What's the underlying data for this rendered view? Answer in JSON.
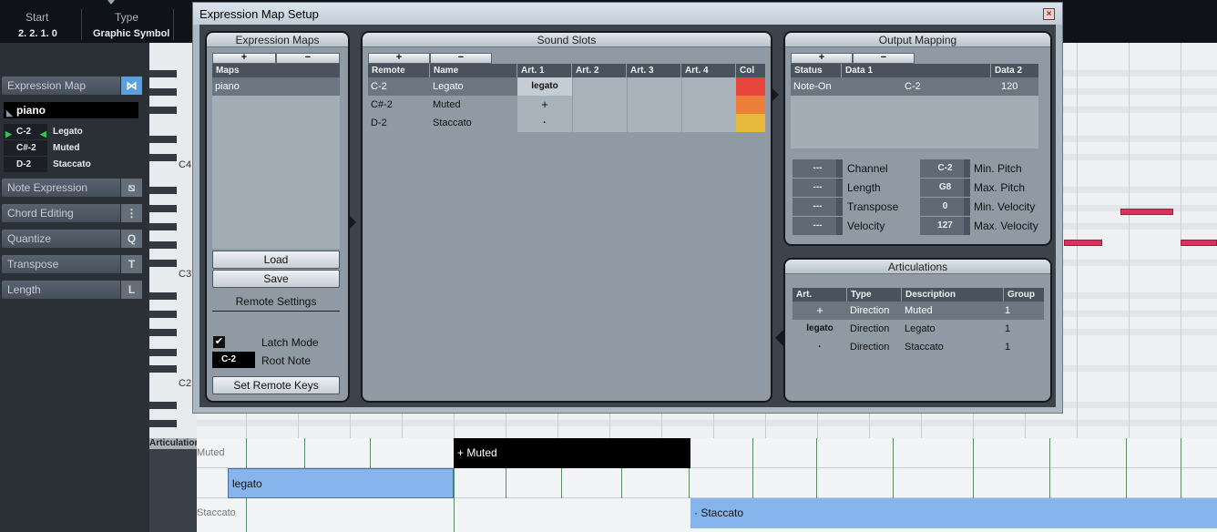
{
  "top_info": {
    "start_label": "Start",
    "start_value": "2. 2. 1.   0",
    "type_label": "Type",
    "type_value": "Graphic Symbol"
  },
  "inspector": {
    "expression_map_label": "Expression Map",
    "expression_map_value": "piano",
    "articulations": [
      {
        "note": "C-2",
        "name": "Legato",
        "playing": true
      },
      {
        "note": "C#-2",
        "name": "Muted",
        "playing": false
      },
      {
        "note": "D-2",
        "name": "Staccato",
        "playing": false
      }
    ],
    "sections": [
      {
        "label": "Note Expression",
        "icon": "note-expression-icon",
        "glyph": "⧅"
      },
      {
        "label": "Chord Editing",
        "icon": "chord-editing-icon",
        "glyph": "⋮"
      },
      {
        "label": "Quantize",
        "icon": "quantize-icon",
        "glyph": "Q"
      },
      {
        "label": "Transpose",
        "icon": "transpose-icon",
        "glyph": "T"
      },
      {
        "label": "Length",
        "icon": "length-icon",
        "glyph": "L"
      }
    ]
  },
  "keyboard": {
    "labels": [
      "C4",
      "C3",
      "C2"
    ]
  },
  "lanes": {
    "title": "Articulations",
    "rows": [
      {
        "label": "Muted",
        "bar_text": "+ Muted"
      },
      {
        "label": "",
        "bar_text": "legato"
      },
      {
        "label": "Staccato",
        "bar_text": "· Staccato"
      }
    ]
  },
  "dialog": {
    "title": "Expression Map Setup",
    "close": "×",
    "expression_maps": {
      "title": "Expression Maps",
      "add": "+",
      "remove": "−",
      "column": "Maps",
      "items": [
        "piano"
      ],
      "load": "Load",
      "save": "Save",
      "remote_settings": "Remote Settings",
      "latch_mode": "Latch Mode",
      "latch_checked": true,
      "root_note_value": "C-2",
      "root_note_label": "Root Note",
      "set_remote_keys": "Set Remote Keys"
    },
    "sound_slots": {
      "title": "Sound Slots",
      "add": "+",
      "remove": "−",
      "columns": [
        "Remote",
        "Name",
        "Art. 1",
        "Art. 2",
        "Art. 3",
        "Art. 4",
        "Col"
      ],
      "rows": [
        {
          "remote": "C-2",
          "name": "Legato",
          "art1": "legato",
          "art2": "",
          "art3": "",
          "art4": "",
          "color": "#e8463c"
        },
        {
          "remote": "C#-2",
          "name": "Muted",
          "art1": "+",
          "art2": "",
          "art3": "",
          "art4": "",
          "color": "#ec7e3a"
        },
        {
          "remote": "D-2",
          "name": "Staccato",
          "art1": "·",
          "art2": "",
          "art3": "",
          "art4": "",
          "color": "#e8b93c"
        }
      ]
    },
    "output_mapping": {
      "title": "Output Mapping",
      "add": "+",
      "remove": "−",
      "columns": [
        "Status",
        "Data 1",
        "Data 2"
      ],
      "rows": [
        {
          "status": "Note-On",
          "data1": "C-2",
          "data2": "120"
        }
      ],
      "settings": [
        {
          "value": "---",
          "label": "Channel",
          "value2": "C-2",
          "label2": "Min. Pitch"
        },
        {
          "value": "---",
          "label": "Length",
          "value2": "G8",
          "label2": "Max. Pitch"
        },
        {
          "value": "---",
          "label": "Transpose",
          "value2": "0",
          "label2": "Min. Velocity"
        },
        {
          "value": "---",
          "label": "Velocity",
          "value2": "127",
          "label2": "Max. Velocity"
        }
      ]
    },
    "articulations": {
      "title": "Articulations",
      "columns": [
        "Art.",
        "Type",
        "Description",
        "Group"
      ],
      "rows": [
        {
          "art": "+",
          "type": "Direction",
          "description": "Muted",
          "group": "1"
        },
        {
          "art": "legato",
          "type": "Direction",
          "description": "Legato",
          "group": "1"
        },
        {
          "art": "·",
          "type": "Direction",
          "description": "Staccato",
          "group": "1"
        }
      ]
    }
  }
}
